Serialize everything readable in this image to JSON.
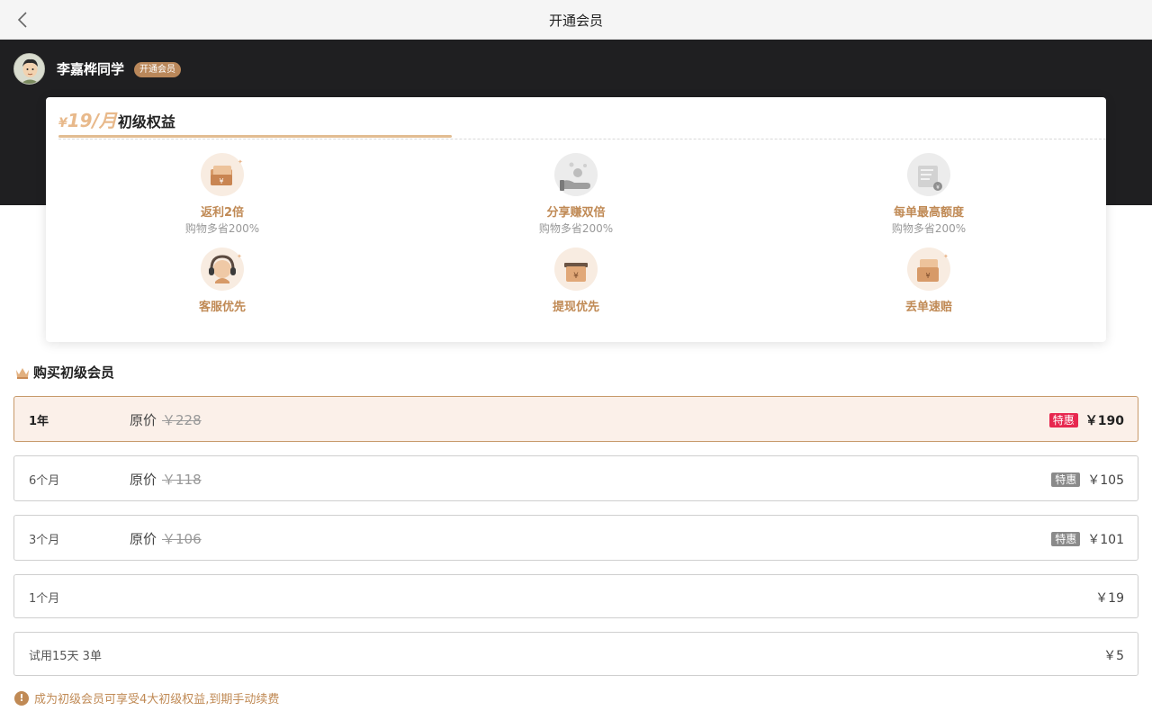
{
  "nav": {
    "title": "开通会员"
  },
  "user": {
    "name": "李嘉桦同学",
    "badge": "开通会员"
  },
  "card": {
    "currency": "¥",
    "price": "19/月",
    "title": "初级权益",
    "benefits": [
      {
        "name": "返利2倍",
        "desc": "购物多省200%",
        "icon": "wallet-coin-icon"
      },
      {
        "name": "分享赚双倍",
        "desc": "购物多省200%",
        "icon": "share-hand-icon"
      },
      {
        "name": "每单最高额度",
        "desc": "购物多省200%",
        "icon": "document-coin-icon"
      },
      {
        "name": "客服优先",
        "desc": "",
        "icon": "headset-icon"
      },
      {
        "name": "提现优先",
        "desc": "",
        "icon": "cash-box-icon"
      },
      {
        "name": "丢单速赔",
        "desc": "",
        "icon": "wallet-coin-icon"
      }
    ]
  },
  "purchase": {
    "title": "购买初级会员"
  },
  "plans": [
    {
      "term": "1年",
      "orig_label": "原价",
      "orig_price": "￥228",
      "badge": "特惠",
      "price": "￥190"
    },
    {
      "term": "6个月",
      "orig_label": "原价",
      "orig_price": "￥118",
      "badge": "特惠",
      "price": "￥105"
    },
    {
      "term": "3个月",
      "orig_label": "原价",
      "orig_price": "￥106",
      "badge": "特惠",
      "price": "￥101"
    },
    {
      "term": "1个月",
      "price": "￥19"
    },
    {
      "term": "试用15天 3单",
      "price": "￥5"
    }
  ],
  "notice": {
    "icon_text": "!",
    "text": "成为初级会员可享受4大初级权益,到期手动续费"
  },
  "colors": {
    "gold": "#c08a55",
    "hero_bg": "#1f1f21",
    "sale_badge": "#e7284f"
  }
}
